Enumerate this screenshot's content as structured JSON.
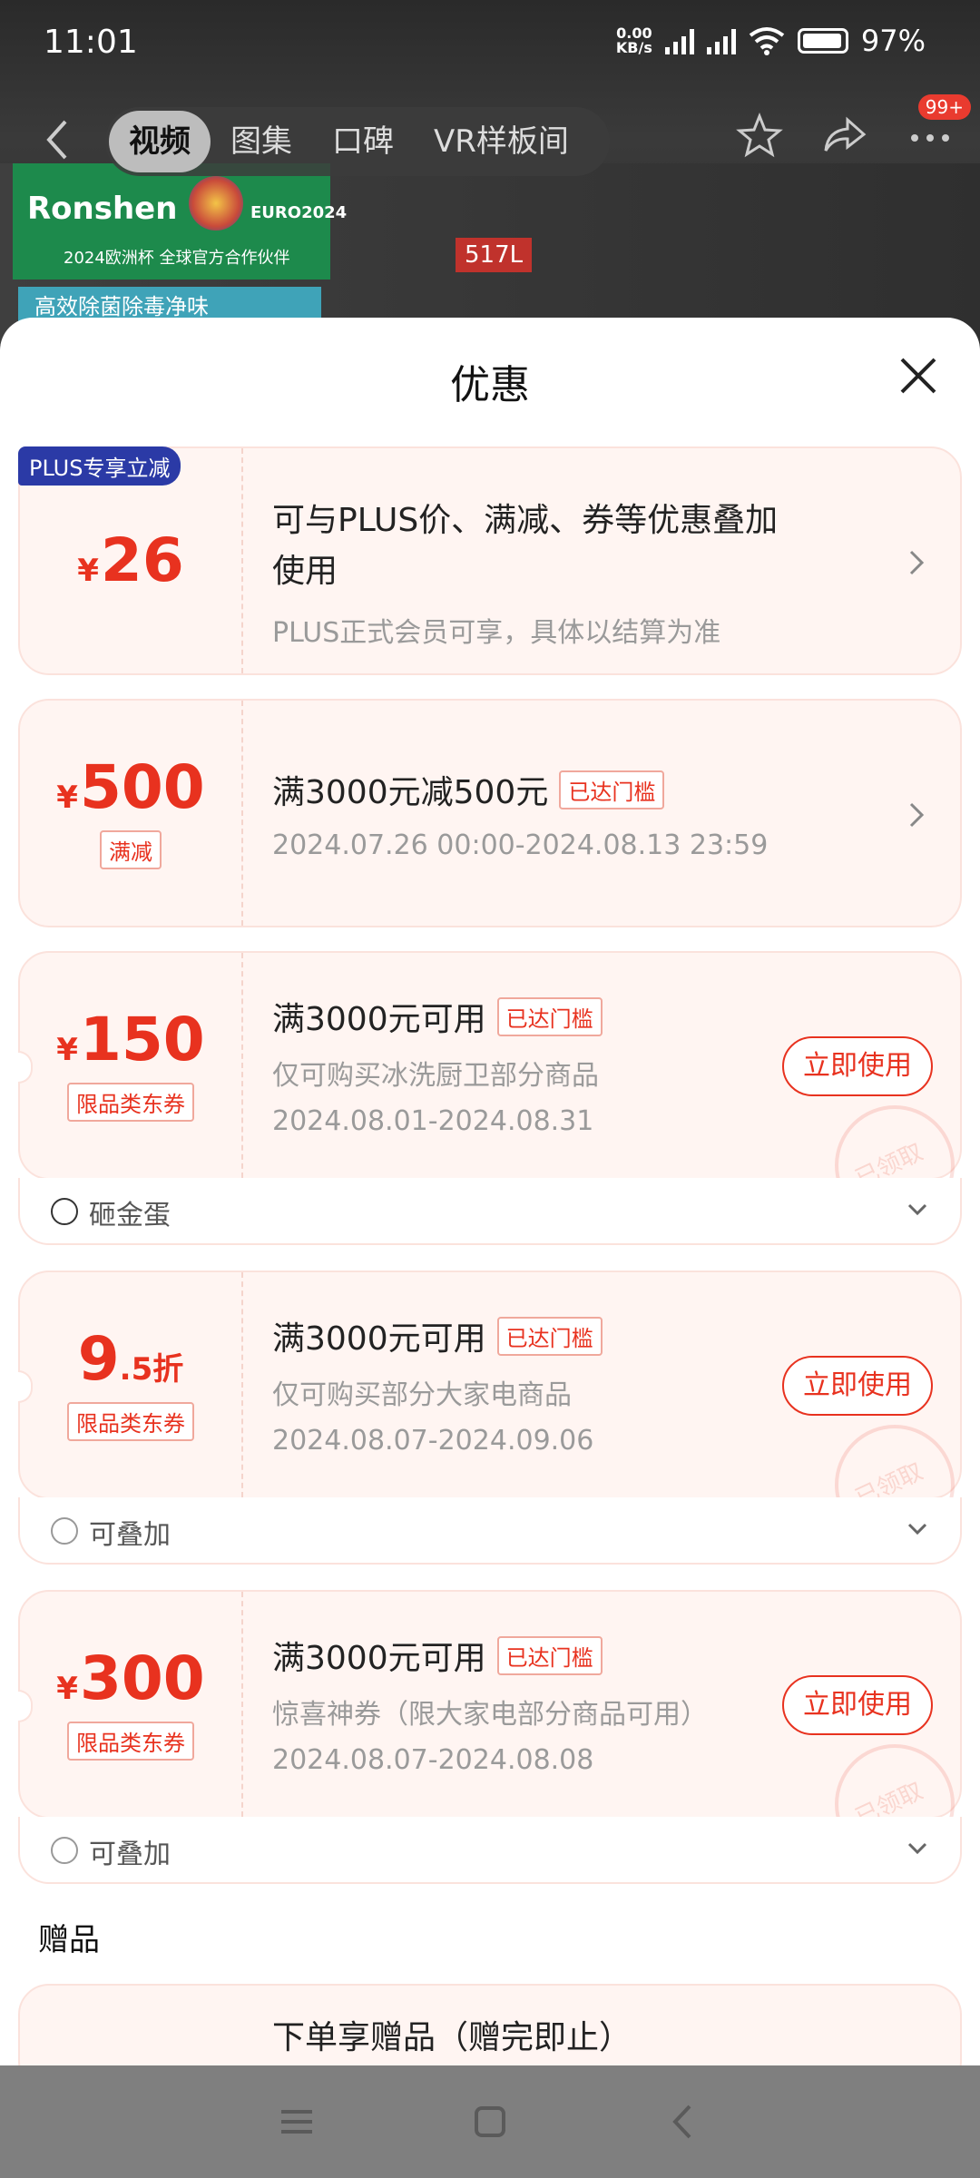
{
  "status": {
    "time": "11:01",
    "net_speed": "0.00",
    "net_unit": "KB/s",
    "battery": "97%"
  },
  "topnav": {
    "tabs": [
      "视频",
      "图集",
      "口碑",
      "VR样板间"
    ],
    "badge": "99+"
  },
  "hero": {
    "brand": "Ronshen",
    "euro": "EURO2024",
    "partner": "2024欧洲杯 全球官方合作伙伴",
    "banner": "高效除菌除毒净味",
    "capacity": "517L"
  },
  "sheet": {
    "title": "优惠"
  },
  "coupons": [
    {
      "tag": "PLUS专享立减",
      "yen": "¥",
      "amount": "26",
      "title_line1": "可与PLUS价、满减、券等优惠叠加",
      "title_line2": "使用",
      "desc": "PLUS正式会员可享，具体以结算为准"
    },
    {
      "yen": "¥",
      "amount": "500",
      "type": "满减",
      "title": "满3000元减500元",
      "reach": "已达门槛",
      "date": "2024.07.26 00:00-2024.08.13 23:59"
    },
    {
      "yen": "¥",
      "amount": "150",
      "type": "限品类东券",
      "title": "满3000元可用",
      "reach": "已达门槛",
      "desc": "仅可购买冰洗厨卫部分商品",
      "date": "2024.08.01-2024.08.31",
      "button": "立即使用",
      "stamp": "已领取",
      "footer": "砸金蛋"
    },
    {
      "amount": "9",
      "unit": ".5折",
      "type": "限品类东券",
      "title": "满3000元可用",
      "reach": "已达门槛",
      "desc": "仅可购买部分大家电商品",
      "date": "2024.08.07-2024.09.06",
      "button": "立即使用",
      "stamp": "已领取",
      "footer": "可叠加"
    },
    {
      "yen": "¥",
      "amount": "300",
      "type": "限品类东券",
      "title": "满3000元可用",
      "reach": "已达门槛",
      "desc": "惊喜神券（限大家电部分商品可用）",
      "date": "2024.08.07-2024.08.08",
      "button": "立即使用",
      "stamp": "已领取",
      "footer": "可叠加"
    }
  ],
  "gift": {
    "section": "赠品",
    "title": "下单享赠品（赠完即止）"
  }
}
